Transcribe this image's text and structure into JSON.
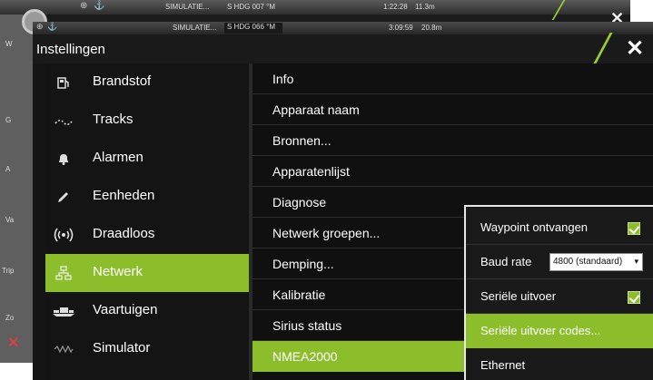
{
  "back_window": {
    "status": {
      "simulating": "SIMULATIE...",
      "heading": "S HDG 007 °M",
      "time": "1:22:28",
      "distance": "11.3m"
    },
    "left_labels": [
      "W",
      "G",
      "A",
      "Va",
      "Trip",
      "Zo"
    ]
  },
  "status_bar": {
    "simulating": "SIMULATIE...",
    "heading": "S HDG 066 °M",
    "time": "3:09:59",
    "distance": "20.8m"
  },
  "title": "Instellingen",
  "left_menu": [
    {
      "label": "Brandstof",
      "icon": "fuel-icon"
    },
    {
      "label": "Tracks",
      "icon": "tracks-icon"
    },
    {
      "label": "Alarmen",
      "icon": "bell-icon"
    },
    {
      "label": "Eenheden",
      "icon": "pencil-icon"
    },
    {
      "label": "Draadloos",
      "icon": "wireless-icon"
    },
    {
      "label": "Netwerk",
      "icon": "network-icon",
      "active": true
    },
    {
      "label": "Vaartuigen",
      "icon": "vessels-icon"
    },
    {
      "label": "Simulator",
      "icon": "simulator-icon"
    }
  ],
  "right_list": [
    "Info",
    "Apparaat naam",
    "Bronnen...",
    "Apparatenlijst",
    "Diagnose",
    "Netwerk groepen...",
    "Demping...",
    "Kalibratie",
    "Sirius status",
    "NMEA2000"
  ],
  "popup": {
    "waypoint_label": "Waypoint ontvangen",
    "waypoint_checked": true,
    "baud_label": "Baud rate",
    "baud_value": "4800 (standaard)",
    "serial_output_label": "Seriële uitvoer",
    "serial_output_checked": true,
    "serial_codes_label": "Seriële uitvoer codes...",
    "ethernet_label": "Ethernet"
  },
  "colors": {
    "accent": "#8cbd2a",
    "background": "#151515"
  }
}
